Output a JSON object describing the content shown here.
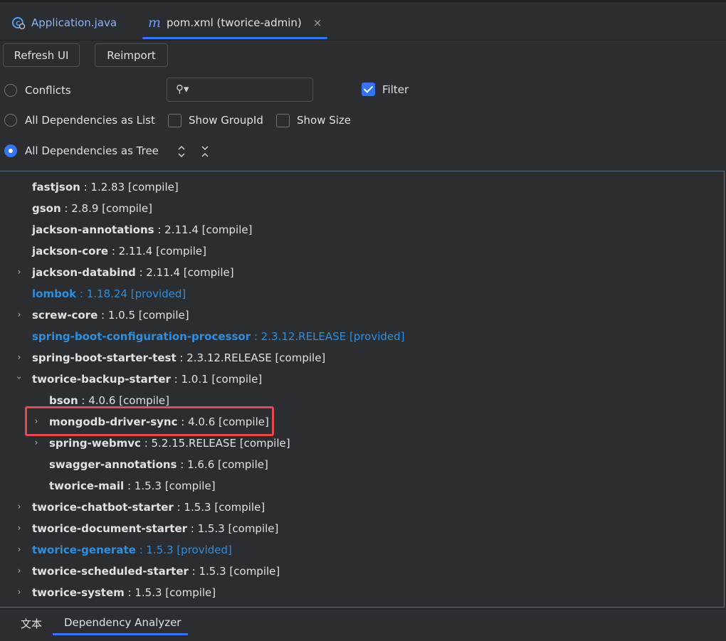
{
  "tabs": [
    {
      "label": "Application.java",
      "icon": "java-class-icon"
    },
    {
      "label": "pom.xml (tworice-admin)",
      "icon": "maven-m-icon",
      "close": "×"
    }
  ],
  "toolbar": {
    "refresh_label": "Refresh UI",
    "reimport_label": "Reimport"
  },
  "options": {
    "conflicts": "Conflicts",
    "as_list": "All Dependencies as List",
    "as_tree": "All Dependencies as Tree",
    "show_groupid": "Show GroupId",
    "show_size": "Show Size",
    "filter": "Filter",
    "search_value": ""
  },
  "tree": [
    {
      "name": "fastjson",
      "ver": " : 1.2.83 [compile]"
    },
    {
      "name": "gson",
      "ver": " : 2.8.9 [compile]"
    },
    {
      "name": "jackson-annotations",
      "ver": " : 2.11.4 [compile]"
    },
    {
      "name": "jackson-core",
      "ver": " : 2.11.4 [compile]"
    },
    {
      "name": "jackson-databind",
      "ver": " : 2.11.4 [compile]"
    },
    {
      "name": "lombok",
      "ver": " : 1.18.24 [provided]"
    },
    {
      "name": "screw-core",
      "ver": " : 1.0.5 [compile]"
    },
    {
      "name": "spring-boot-configuration-processor",
      "ver": " : 2.3.12.RELEASE [provided]"
    },
    {
      "name": "spring-boot-starter-test",
      "ver": " : 2.3.12.RELEASE [compile]"
    },
    {
      "name": "tworice-backup-starter",
      "ver": " : 1.0.1 [compile]"
    },
    {
      "name": "bson",
      "ver": " : 4.0.6 [compile]"
    },
    {
      "name": "mongodb-driver-sync",
      "ver": " : 4.0.6 [compile]"
    },
    {
      "name": "spring-webmvc",
      "ver": " : 5.2.15.RELEASE [compile]"
    },
    {
      "name": "swagger-annotations",
      "ver": " : 1.6.6 [compile]"
    },
    {
      "name": "tworice-mail",
      "ver": " : 1.5.3 [compile]"
    },
    {
      "name": "tworice-chatbot-starter",
      "ver": " : 1.5.3 [compile]"
    },
    {
      "name": "tworice-document-starter",
      "ver": " : 1.5.3 [compile]"
    },
    {
      "name": "tworice-generate",
      "ver": " : 1.5.3 [provided]"
    },
    {
      "name": "tworice-scheduled-starter",
      "ver": " : 1.5.3 [compile]"
    },
    {
      "name": "tworice-system",
      "ver": " : 1.5.3 [compile]"
    }
  ],
  "bottom_tabs": [
    "文本",
    "Dependency Analyzer"
  ]
}
